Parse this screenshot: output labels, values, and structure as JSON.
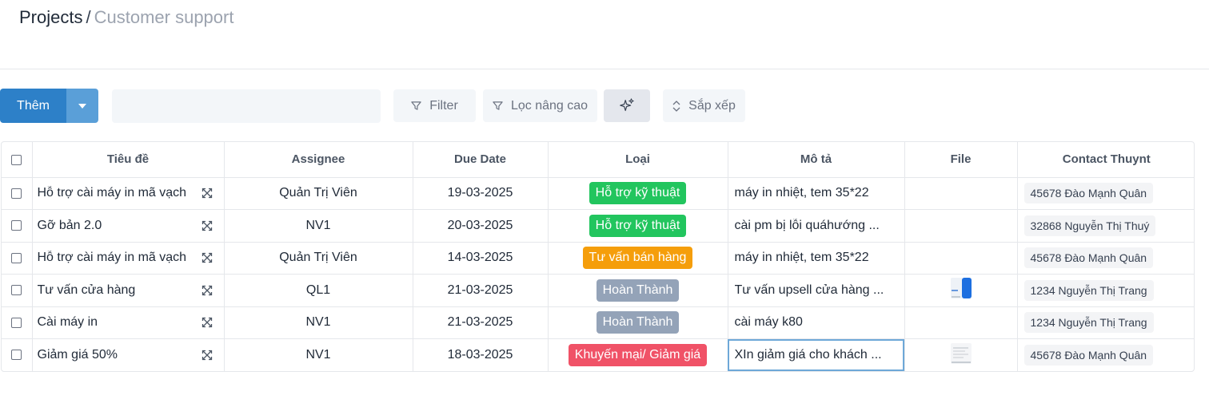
{
  "breadcrumb": {
    "root": "Projects",
    "separator": "/",
    "current": "Customer support"
  },
  "toolbar": {
    "add_label": "Thêm",
    "search_value": "",
    "search_placeholder": "",
    "filter_label": "Filter",
    "advanced_filter_label": "Lọc nâng cao",
    "sort_label": "Sắp xếp"
  },
  "table": {
    "headers": {
      "title": "Tiêu đề",
      "assignee": "Assignee",
      "due_date": "Due Date",
      "type": "Loại",
      "description": "Mô tả",
      "file": "File",
      "contact": "Contact Thuynt"
    },
    "rows": [
      {
        "title": "Hỗ trợ cài máy in mã vạch",
        "assignee": "Quản Trị Viên",
        "due_date": "19-03-2025",
        "type": "Hỗ trợ kỹ thuật",
        "type_color": "#22c55e",
        "description": "máy in nhiệt, tem 35*22",
        "file": "",
        "contact": "45678 Đào Mạnh Quân"
      },
      {
        "title": "Gỡ bản 2.0",
        "assignee": "NV1",
        "due_date": "20-03-2025",
        "type": "Hỗ trợ kỹ thuật",
        "type_color": "#22c55e",
        "description": "cài pm bị lỗi quáhướng ...",
        "file": "",
        "contact": "32868 Nguyễn Thị Thuý"
      },
      {
        "title": "Hỗ trợ cài máy in mã vạch",
        "assignee": "Quản Trị Viên",
        "due_date": "14-03-2025",
        "type": "Tư vấn bán hàng",
        "type_color": "#f59e0b",
        "description": "máy in nhiệt, tem 35*22",
        "file": "",
        "contact": "45678 Đào Mạnh Quân"
      },
      {
        "title": "Tư vấn cửa hàng",
        "assignee": "QL1",
        "due_date": "21-03-2025",
        "type": "Hoàn Thành",
        "type_color": "#94a3b8",
        "description": "Tư vấn upsell cửa hàng ...",
        "file": "document-thumbnail",
        "contact": "1234 Nguyễn Thị Trang"
      },
      {
        "title": "Cài máy in",
        "assignee": "NV1",
        "due_date": "21-03-2025",
        "type": "Hoàn Thành",
        "type_color": "#94a3b8",
        "description": "cài máy k80",
        "file": "",
        "contact": "1234 Nguyễn Thị Trang"
      },
      {
        "title": "Giảm giá 50%",
        "assignee": "NV1",
        "due_date": "18-03-2025",
        "type": "Khuyến mại/ Giảm giá",
        "type_color": "#f05267",
        "description": "XIn giảm giá cho khách ...",
        "file": "image-thumbnail",
        "contact": "45678 Đào Mạnh Quân"
      }
    ]
  },
  "colors": {
    "primary": "#2d80c8",
    "primary_light": "#5a9fd8",
    "muted_text": "#9ca3af"
  },
  "icons": [
    "chevron-down-icon",
    "filter-icon",
    "sparkle-icon",
    "sort-icon",
    "expand-icon",
    "checkbox-icon"
  ]
}
